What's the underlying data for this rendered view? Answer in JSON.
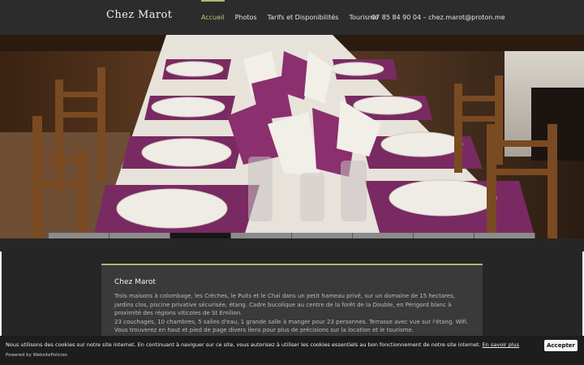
{
  "header": {
    "brand": "Chez Marot",
    "nav": [
      "Accueil",
      "Photos",
      "Tarifs et Disponibilités",
      "Tourisme"
    ],
    "contact": "07 85 84 90 04 – chez.marot@proton.me",
    "accent": "#a9bb6e"
  },
  "hero": {
    "active_slide": 3,
    "slide_count": 8
  },
  "main": {
    "title": "Chez Marot",
    "paragraph_1": "Trois maisons à colombage, les Crèches, le Puits et le Chai dans un petit hameau privé, sur un domaine de 15 hectares, jardins clos, piscine privative sécurisée, étang. Cadre bucolique au centre de la forêt de la Double, en Périgord blanc à proximité des régions viticoles de St Emilion.",
    "paragraph_2": "23 couchages, 10 chambres, 5 salles d'eau, 1 grande salle à manger pour 23 personnes. Terrasse avec vue sur l'étang. Wifi.",
    "paragraph_3": "Vous trouverez en haut et pied de page divers liens pour plus de précisions sur la location et le tourisme."
  },
  "cookie": {
    "text": "Nous utilisons des cookies sur notre site internet. En continuant à naviguer sur ce site, vous autorisez à utiliser les cookies essentiels au bon fonctionnement de notre site internet.",
    "link": "En savoir plus",
    "powered": "Powered by WebsitePolicies",
    "accept": "Accepter"
  }
}
